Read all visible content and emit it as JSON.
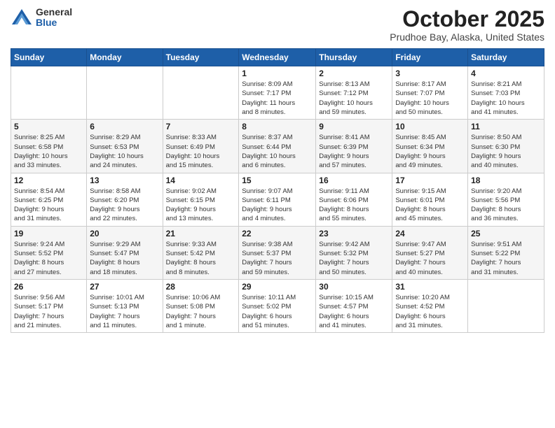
{
  "logo": {
    "general": "General",
    "blue": "Blue"
  },
  "title": "October 2025",
  "subtitle": "Prudhoe Bay, Alaska, United States",
  "weekdays": [
    "Sunday",
    "Monday",
    "Tuesday",
    "Wednesday",
    "Thursday",
    "Friday",
    "Saturday"
  ],
  "weeks": [
    [
      {
        "day": "",
        "info": ""
      },
      {
        "day": "",
        "info": ""
      },
      {
        "day": "",
        "info": ""
      },
      {
        "day": "1",
        "info": "Sunrise: 8:09 AM\nSunset: 7:17 PM\nDaylight: 11 hours\nand 8 minutes."
      },
      {
        "day": "2",
        "info": "Sunrise: 8:13 AM\nSunset: 7:12 PM\nDaylight: 10 hours\nand 59 minutes."
      },
      {
        "day": "3",
        "info": "Sunrise: 8:17 AM\nSunset: 7:07 PM\nDaylight: 10 hours\nand 50 minutes."
      },
      {
        "day": "4",
        "info": "Sunrise: 8:21 AM\nSunset: 7:03 PM\nDaylight: 10 hours\nand 41 minutes."
      }
    ],
    [
      {
        "day": "5",
        "info": "Sunrise: 8:25 AM\nSunset: 6:58 PM\nDaylight: 10 hours\nand 33 minutes."
      },
      {
        "day": "6",
        "info": "Sunrise: 8:29 AM\nSunset: 6:53 PM\nDaylight: 10 hours\nand 24 minutes."
      },
      {
        "day": "7",
        "info": "Sunrise: 8:33 AM\nSunset: 6:49 PM\nDaylight: 10 hours\nand 15 minutes."
      },
      {
        "day": "8",
        "info": "Sunrise: 8:37 AM\nSunset: 6:44 PM\nDaylight: 10 hours\nand 6 minutes."
      },
      {
        "day": "9",
        "info": "Sunrise: 8:41 AM\nSunset: 6:39 PM\nDaylight: 9 hours\nand 57 minutes."
      },
      {
        "day": "10",
        "info": "Sunrise: 8:45 AM\nSunset: 6:34 PM\nDaylight: 9 hours\nand 49 minutes."
      },
      {
        "day": "11",
        "info": "Sunrise: 8:50 AM\nSunset: 6:30 PM\nDaylight: 9 hours\nand 40 minutes."
      }
    ],
    [
      {
        "day": "12",
        "info": "Sunrise: 8:54 AM\nSunset: 6:25 PM\nDaylight: 9 hours\nand 31 minutes."
      },
      {
        "day": "13",
        "info": "Sunrise: 8:58 AM\nSunset: 6:20 PM\nDaylight: 9 hours\nand 22 minutes."
      },
      {
        "day": "14",
        "info": "Sunrise: 9:02 AM\nSunset: 6:15 PM\nDaylight: 9 hours\nand 13 minutes."
      },
      {
        "day": "15",
        "info": "Sunrise: 9:07 AM\nSunset: 6:11 PM\nDaylight: 9 hours\nand 4 minutes."
      },
      {
        "day": "16",
        "info": "Sunrise: 9:11 AM\nSunset: 6:06 PM\nDaylight: 8 hours\nand 55 minutes."
      },
      {
        "day": "17",
        "info": "Sunrise: 9:15 AM\nSunset: 6:01 PM\nDaylight: 8 hours\nand 45 minutes."
      },
      {
        "day": "18",
        "info": "Sunrise: 9:20 AM\nSunset: 5:56 PM\nDaylight: 8 hours\nand 36 minutes."
      }
    ],
    [
      {
        "day": "19",
        "info": "Sunrise: 9:24 AM\nSunset: 5:52 PM\nDaylight: 8 hours\nand 27 minutes."
      },
      {
        "day": "20",
        "info": "Sunrise: 9:29 AM\nSunset: 5:47 PM\nDaylight: 8 hours\nand 18 minutes."
      },
      {
        "day": "21",
        "info": "Sunrise: 9:33 AM\nSunset: 5:42 PM\nDaylight: 8 hours\nand 8 minutes."
      },
      {
        "day": "22",
        "info": "Sunrise: 9:38 AM\nSunset: 5:37 PM\nDaylight: 7 hours\nand 59 minutes."
      },
      {
        "day": "23",
        "info": "Sunrise: 9:42 AM\nSunset: 5:32 PM\nDaylight: 7 hours\nand 50 minutes."
      },
      {
        "day": "24",
        "info": "Sunrise: 9:47 AM\nSunset: 5:27 PM\nDaylight: 7 hours\nand 40 minutes."
      },
      {
        "day": "25",
        "info": "Sunrise: 9:51 AM\nSunset: 5:22 PM\nDaylight: 7 hours\nand 31 minutes."
      }
    ],
    [
      {
        "day": "26",
        "info": "Sunrise: 9:56 AM\nSunset: 5:17 PM\nDaylight: 7 hours\nand 21 minutes."
      },
      {
        "day": "27",
        "info": "Sunrise: 10:01 AM\nSunset: 5:13 PM\nDaylight: 7 hours\nand 11 minutes."
      },
      {
        "day": "28",
        "info": "Sunrise: 10:06 AM\nSunset: 5:08 PM\nDaylight: 7 hours\nand 1 minute."
      },
      {
        "day": "29",
        "info": "Sunrise: 10:11 AM\nSunset: 5:02 PM\nDaylight: 6 hours\nand 51 minutes."
      },
      {
        "day": "30",
        "info": "Sunrise: 10:15 AM\nSunset: 4:57 PM\nDaylight: 6 hours\nand 41 minutes."
      },
      {
        "day": "31",
        "info": "Sunrise: 10:20 AM\nSunset: 4:52 PM\nDaylight: 6 hours\nand 31 minutes."
      },
      {
        "day": "",
        "info": ""
      }
    ]
  ]
}
